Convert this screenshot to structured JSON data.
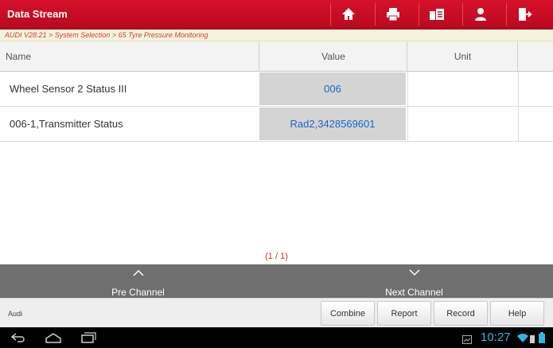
{
  "header": {
    "title": "Data Stream",
    "icons": [
      "home-icon",
      "print-icon",
      "report-icon",
      "user-icon",
      "exit-icon"
    ]
  },
  "breadcrumb": "AUDI V28.21 > System Selection > 65 Tyre Pressure Monitoring",
  "table": {
    "columns": {
      "name": "Name",
      "value": "Value",
      "unit": "Unit"
    },
    "rows": [
      {
        "name": "Wheel Sensor 2 Status III",
        "value": "006",
        "unit": ""
      },
      {
        "name": "006-1,Transmitter Status",
        "value": "Rad2,3428569601",
        "unit": ""
      }
    ]
  },
  "pagination": "(1 / 1)",
  "channel": {
    "prev": "Pre Channel",
    "next": "Next Channel"
  },
  "footer": {
    "brand": "Audi",
    "buttons": {
      "combine": "Combine",
      "report": "Report",
      "record": "Record",
      "help": "Help"
    }
  },
  "status": {
    "time": "10:27"
  },
  "colors": {
    "header": "#c80d23",
    "value_text": "#1a66c8",
    "clock": "#33b5e5"
  }
}
